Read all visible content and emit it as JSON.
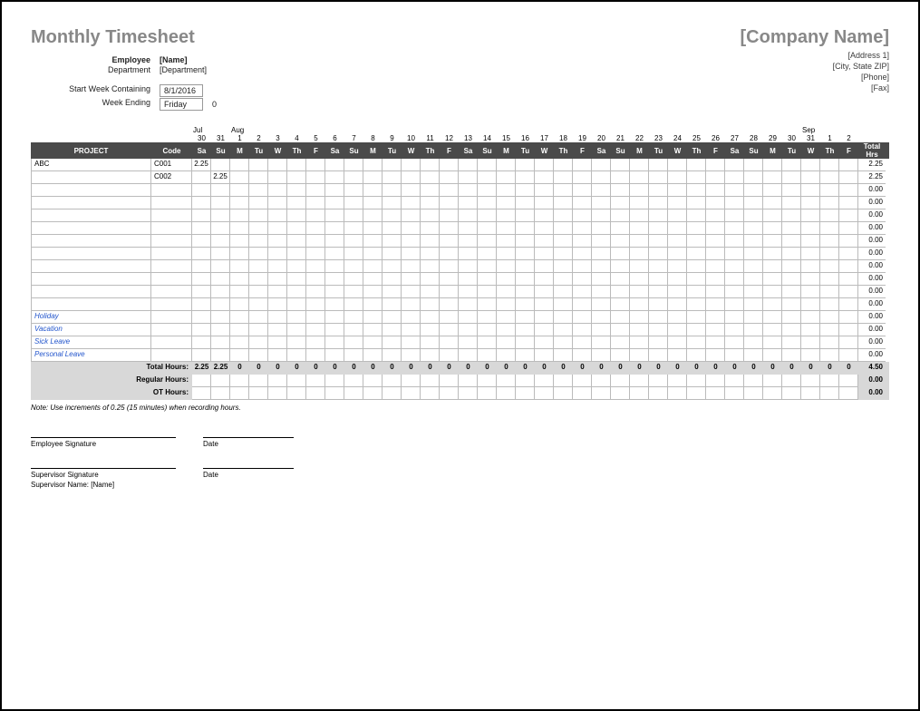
{
  "title": "Monthly Timesheet",
  "company": {
    "name": "[Company Name]",
    "address1": "[Address 1]",
    "city_state_zip": "[City, State  ZIP]",
    "phone": "[Phone]",
    "fax": "[Fax]"
  },
  "employee": {
    "label": "Employee",
    "name": "[Name]",
    "department_label": "Department",
    "department": "[Department]"
  },
  "period": {
    "start_label": "Start Week Containing",
    "start_value": "8/1/2016",
    "ending_label": "Week Ending",
    "ending_value": "Friday",
    "ending_extra": "0"
  },
  "columns": {
    "project": "PROJECT",
    "code": "Code",
    "total": "Total\nHrs"
  },
  "months_row": [
    "Jul",
    "",
    "Aug",
    "",
    "",
    "",
    "",
    "",
    "",
    "",
    "",
    "",
    "",
    "",
    "",
    "",
    "",
    "",
    "",
    "",
    "",
    "",
    "",
    "",
    "",
    "",
    "",
    "",
    "",
    "",
    "",
    "",
    "Sep",
    ""
  ],
  "dates_row": [
    "30",
    "31",
    "1",
    "2",
    "3",
    "4",
    "5",
    "6",
    "7",
    "8",
    "9",
    "10",
    "11",
    "12",
    "13",
    "14",
    "15",
    "16",
    "17",
    "18",
    "19",
    "20",
    "21",
    "22",
    "23",
    "24",
    "25",
    "26",
    "27",
    "28",
    "29",
    "30",
    "31",
    "1",
    "2"
  ],
  "dow_row": [
    "Sa",
    "Su",
    "M",
    "Tu",
    "W",
    "Th",
    "F",
    "Sa",
    "Su",
    "M",
    "Tu",
    "W",
    "Th",
    "F",
    "Sa",
    "Su",
    "M",
    "Tu",
    "W",
    "Th",
    "F",
    "Sa",
    "Su",
    "M",
    "Tu",
    "W",
    "Th",
    "F",
    "Sa",
    "Su",
    "M",
    "Tu",
    "W",
    "Th",
    "F"
  ],
  "rows": [
    {
      "project": "ABC",
      "code": "C001",
      "days": [
        "2.25",
        "",
        "",
        "",
        "",
        "",
        "",
        "",
        "",
        "",
        "",
        "",
        "",
        "",
        "",
        "",
        "",
        "",
        "",
        "",
        "",
        "",
        "",
        "",
        "",
        "",
        "",
        "",
        "",
        "",
        "",
        "",
        "",
        "",
        ""
      ],
      "total": "2.25"
    },
    {
      "project": "",
      "code": "C002",
      "days": [
        "",
        "2.25",
        "",
        "",
        "",
        "",
        "",
        "",
        "",
        "",
        "",
        "",
        "",
        "",
        "",
        "",
        "",
        "",
        "",
        "",
        "",
        "",
        "",
        "",
        "",
        "",
        "",
        "",
        "",
        "",
        "",
        "",
        "",
        "",
        ""
      ],
      "total": "2.25"
    },
    {
      "project": "",
      "code": "",
      "days": [
        "",
        "",
        "",
        "",
        "",
        "",
        "",
        "",
        "",
        "",
        "",
        "",
        "",
        "",
        "",
        "",
        "",
        "",
        "",
        "",
        "",
        "",
        "",
        "",
        "",
        "",
        "",
        "",
        "",
        "",
        "",
        "",
        "",
        "",
        ""
      ],
      "total": "0.00"
    },
    {
      "project": "",
      "code": "",
      "days": [
        "",
        "",
        "",
        "",
        "",
        "",
        "",
        "",
        "",
        "",
        "",
        "",
        "",
        "",
        "",
        "",
        "",
        "",
        "",
        "",
        "",
        "",
        "",
        "",
        "",
        "",
        "",
        "",
        "",
        "",
        "",
        "",
        "",
        "",
        ""
      ],
      "total": "0.00"
    },
    {
      "project": "",
      "code": "",
      "days": [
        "",
        "",
        "",
        "",
        "",
        "",
        "",
        "",
        "",
        "",
        "",
        "",
        "",
        "",
        "",
        "",
        "",
        "",
        "",
        "",
        "",
        "",
        "",
        "",
        "",
        "",
        "",
        "",
        "",
        "",
        "",
        "",
        "",
        "",
        ""
      ],
      "total": "0.00"
    },
    {
      "project": "",
      "code": "",
      "days": [
        "",
        "",
        "",
        "",
        "",
        "",
        "",
        "",
        "",
        "",
        "",
        "",
        "",
        "",
        "",
        "",
        "",
        "",
        "",
        "",
        "",
        "",
        "",
        "",
        "",
        "",
        "",
        "",
        "",
        "",
        "",
        "",
        "",
        "",
        ""
      ],
      "total": "0.00"
    },
    {
      "project": "",
      "code": "",
      "days": [
        "",
        "",
        "",
        "",
        "",
        "",
        "",
        "",
        "",
        "",
        "",
        "",
        "",
        "",
        "",
        "",
        "",
        "",
        "",
        "",
        "",
        "",
        "",
        "",
        "",
        "",
        "",
        "",
        "",
        "",
        "",
        "",
        "",
        "",
        ""
      ],
      "total": "0.00"
    },
    {
      "project": "",
      "code": "",
      "days": [
        "",
        "",
        "",
        "",
        "",
        "",
        "",
        "",
        "",
        "",
        "",
        "",
        "",
        "",
        "",
        "",
        "",
        "",
        "",
        "",
        "",
        "",
        "",
        "",
        "",
        "",
        "",
        "",
        "",
        "",
        "",
        "",
        "",
        "",
        ""
      ],
      "total": "0.00"
    },
    {
      "project": "",
      "code": "",
      "days": [
        "",
        "",
        "",
        "",
        "",
        "",
        "",
        "",
        "",
        "",
        "",
        "",
        "",
        "",
        "",
        "",
        "",
        "",
        "",
        "",
        "",
        "",
        "",
        "",
        "",
        "",
        "",
        "",
        "",
        "",
        "",
        "",
        "",
        "",
        ""
      ],
      "total": "0.00"
    },
    {
      "project": "",
      "code": "",
      "days": [
        "",
        "",
        "",
        "",
        "",
        "",
        "",
        "",
        "",
        "",
        "",
        "",
        "",
        "",
        "",
        "",
        "",
        "",
        "",
        "",
        "",
        "",
        "",
        "",
        "",
        "",
        "",
        "",
        "",
        "",
        "",
        "",
        "",
        "",
        ""
      ],
      "total": "0.00"
    },
    {
      "project": "",
      "code": "",
      "days": [
        "",
        "",
        "",
        "",
        "",
        "",
        "",
        "",
        "",
        "",
        "",
        "",
        "",
        "",
        "",
        "",
        "",
        "",
        "",
        "",
        "",
        "",
        "",
        "",
        "",
        "",
        "",
        "",
        "",
        "",
        "",
        "",
        "",
        "",
        ""
      ],
      "total": "0.00"
    },
    {
      "project": "",
      "code": "",
      "days": [
        "",
        "",
        "",
        "",
        "",
        "",
        "",
        "",
        "",
        "",
        "",
        "",
        "",
        "",
        "",
        "",
        "",
        "",
        "",
        "",
        "",
        "",
        "",
        "",
        "",
        "",
        "",
        "",
        "",
        "",
        "",
        "",
        "",
        "",
        ""
      ],
      "total": "0.00"
    },
    {
      "project": "Holiday",
      "code": "",
      "blue": true,
      "days": [
        "",
        "",
        "",
        "",
        "",
        "",
        "",
        "",
        "",
        "",
        "",
        "",
        "",
        "",
        "",
        "",
        "",
        "",
        "",
        "",
        "",
        "",
        "",
        "",
        "",
        "",
        "",
        "",
        "",
        "",
        "",
        "",
        "",
        "",
        ""
      ],
      "total": "0.00"
    },
    {
      "project": "Vacation",
      "code": "",
      "blue": true,
      "days": [
        "",
        "",
        "",
        "",
        "",
        "",
        "",
        "",
        "",
        "",
        "",
        "",
        "",
        "",
        "",
        "",
        "",
        "",
        "",
        "",
        "",
        "",
        "",
        "",
        "",
        "",
        "",
        "",
        "",
        "",
        "",
        "",
        "",
        "",
        ""
      ],
      "total": "0.00"
    },
    {
      "project": "Sick Leave",
      "code": "",
      "blue": true,
      "days": [
        "",
        "",
        "",
        "",
        "",
        "",
        "",
        "",
        "",
        "",
        "",
        "",
        "",
        "",
        "",
        "",
        "",
        "",
        "",
        "",
        "",
        "",
        "",
        "",
        "",
        "",
        "",
        "",
        "",
        "",
        "",
        "",
        "",
        "",
        ""
      ],
      "total": "0.00"
    },
    {
      "project": "Personal Leave",
      "code": "",
      "blue": true,
      "days": [
        "",
        "",
        "",
        "",
        "",
        "",
        "",
        "",
        "",
        "",
        "",
        "",
        "",
        "",
        "",
        "",
        "",
        "",
        "",
        "",
        "",
        "",
        "",
        "",
        "",
        "",
        "",
        "",
        "",
        "",
        "",
        "",
        "",
        "",
        ""
      ],
      "total": "0.00"
    }
  ],
  "totals": {
    "total_hours_label": "Total Hours:",
    "total_hours": [
      "2.25",
      "2.25",
      "0",
      "0",
      "0",
      "0",
      "0",
      "0",
      "0",
      "0",
      "0",
      "0",
      "0",
      "0",
      "0",
      "0",
      "0",
      "0",
      "0",
      "0",
      "0",
      "0",
      "0",
      "0",
      "0",
      "0",
      "0",
      "0",
      "0",
      "0",
      "0",
      "0",
      "0",
      "0",
      "0"
    ],
    "total_hours_sum": "4.50",
    "regular_label": "Regular Hours:",
    "regular": [
      "",
      "",
      "",
      "",
      "",
      "",
      "",
      "",
      "",
      "",
      "",
      "",
      "",
      "",
      "",
      "",
      "",
      "",
      "",
      "",
      "",
      "",
      "",
      "",
      "",
      "",
      "",
      "",
      "",
      "",
      "",
      "",
      "",
      "",
      ""
    ],
    "regular_sum": "0.00",
    "ot_label": "OT Hours:",
    "ot": [
      "",
      "",
      "",
      "",
      "",
      "",
      "",
      "",
      "",
      "",
      "",
      "",
      "",
      "",
      "",
      "",
      "",
      "",
      "",
      "",
      "",
      "",
      "",
      "",
      "",
      "",
      "",
      "",
      "",
      "",
      "",
      "",
      "",
      "",
      ""
    ],
    "ot_sum": "0.00"
  },
  "note": "Note: Use increments of 0.25 (15 minutes) when recording hours.",
  "signatures": {
    "employee": "Employee Signature",
    "date": "Date",
    "supervisor": "Supervisor Signature",
    "supervisor_name_label": "Supervisor Name:",
    "supervisor_name_value": "[Name]"
  }
}
